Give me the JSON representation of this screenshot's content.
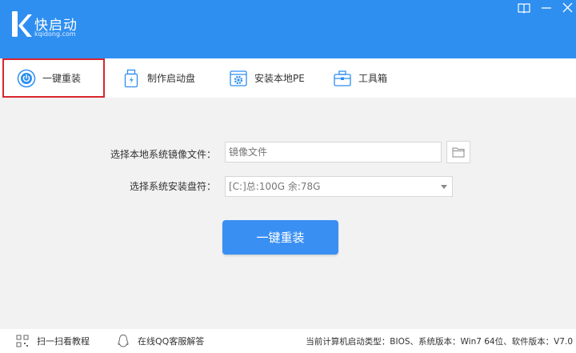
{
  "app": {
    "logo_name": "快启动",
    "logo_url": "kqidong.com"
  },
  "tabs": [
    {
      "label": "一键重装",
      "icon": "power-icon",
      "active": true
    },
    {
      "label": "制作启动盘",
      "icon": "usb-drive-icon"
    },
    {
      "label": "安装本地PE",
      "icon": "gear-box-icon"
    },
    {
      "label": "工具箱",
      "icon": "toolbox-icon"
    }
  ],
  "form": {
    "image_label": "选择本地系统镜像文件：",
    "image_placeholder": "镜像文件",
    "drive_label": "选择系统安装盘符：",
    "drive_value": "[C:]总:100G 余:78G",
    "submit_label": "一键重装"
  },
  "status": {
    "qr_label": "扫一扫看教程",
    "qq_label": "在线QQ客服解答",
    "info": "当前计算机启动类型：BIOS、系统版本：Win7 64位、软件版本：V7.0"
  },
  "colors": {
    "brand": "#2e8ff0",
    "button": "#3a8ff3",
    "active_outline": "#d9252f"
  }
}
